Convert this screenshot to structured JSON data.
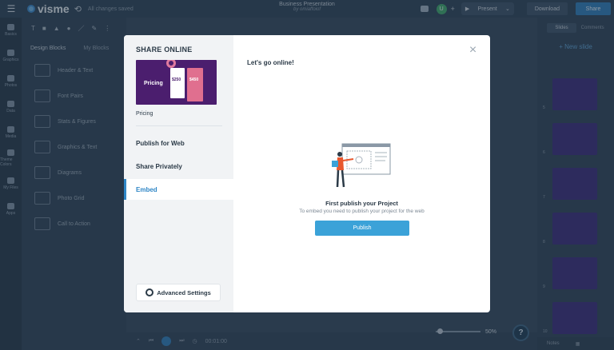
{
  "app": {
    "logo_text": "visme",
    "saved_status": "All changes saved",
    "doc_title": "Business Presentation",
    "doc_author": "by omiaffoiof",
    "avatar_initial": "U",
    "present_label": "Present",
    "download_label": "Download",
    "share_label": "Share"
  },
  "rail": {
    "items": [
      {
        "label": "Basics"
      },
      {
        "label": "Graphics"
      },
      {
        "label": "Photos"
      },
      {
        "label": "Data"
      },
      {
        "label": "Media"
      },
      {
        "label": "Theme Colors"
      },
      {
        "label": "My Files"
      },
      {
        "label": "Apps"
      }
    ]
  },
  "panel": {
    "tab_design_blocks": "Design Blocks",
    "tab_my_blocks": "My Blocks",
    "blocks": [
      {
        "label": "Header & Text"
      },
      {
        "label": "Font Pairs"
      },
      {
        "label": "Stats & Figures"
      },
      {
        "label": "Graphics & Text"
      },
      {
        "label": "Diagrams"
      },
      {
        "label": "Photo Grid"
      },
      {
        "label": "Call to Action"
      }
    ]
  },
  "bottom": {
    "time": "00:01:00",
    "zoom": "50%",
    "help": "?"
  },
  "slides": {
    "tab_slides": "Slides",
    "tab_comments": "Comments",
    "new_slide": "+ New slide",
    "numbers": [
      "5",
      "6",
      "7",
      "8",
      "9",
      "10"
    ],
    "notes_label": "Notes"
  },
  "modal": {
    "title": "SHARE ONLINE",
    "preview_title": "Pricing",
    "preview_price1": "$250",
    "preview_price2": "$450",
    "preview_label": "Pricing",
    "menu": [
      {
        "label": "Publish for Web"
      },
      {
        "label": "Share Privately"
      },
      {
        "label": "Embed"
      }
    ],
    "advanced_settings": "Advanced Settings",
    "heading": "Let's go online!",
    "empty_title": "First publish your Project",
    "empty_subtitle": "To embed you need to publish your project for the web",
    "publish_button": "Publish"
  },
  "colors": {
    "accent": "#2f86c6",
    "publish": "#3ba2d8",
    "slide_purple": "#3a2a78"
  }
}
